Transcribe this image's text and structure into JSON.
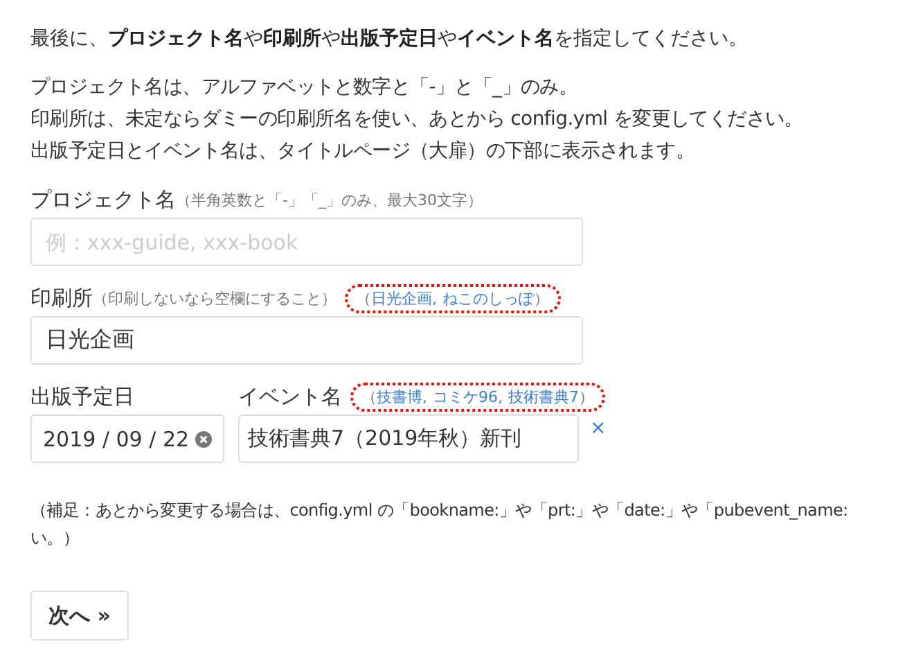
{
  "intro": "最後に、**プロジェクト名**や**印刷所**や**出版予定日**や**イベント名**を指定してください。",
  "notes": [
    "プロジェクト名は、アルファベットと数字と「-」と「_」のみ。",
    "印刷所は、未定ならダミーの印刷所名を使い、あとから config.yml を変更してください。",
    "出版予定日とイベント名は、タイトルページ（大扉）の下部に表示されます。"
  ],
  "project": {
    "label": "プロジェクト名",
    "hint": "（半角英数と「-」「_」のみ、最大30文字）",
    "placeholder": "例：xxx-guide, xxx-book"
  },
  "printer": {
    "label": "印刷所",
    "hint": "（印刷しないなら空欄にすること）",
    "value": "日光企画",
    "suggest_open": "（",
    "suggestions": [
      "日光企画",
      "ねこのしっぽ"
    ],
    "suggest_separator": ",",
    "suggest_close": "）",
    "highlighted": true
  },
  "date": {
    "label": "出版予定日",
    "value": "2019 / 09 / 22"
  },
  "event": {
    "label": "イベント名",
    "value": "技術書典7（2019年秋）新刊",
    "suggest_open": "（",
    "suggestions": [
      "技書博",
      "コミケ96",
      "技術書典7"
    ],
    "suggest_separator": ",",
    "suggest_close": "）",
    "highlighted": true,
    "clear": "×"
  },
  "footnote": [
    "（補足：あとから変更する場合は、config.yml の「bookname:」や「prt:」や「date:」や「pubevent_name:",
    "い。）"
  ],
  "next_button": "次へ »"
}
